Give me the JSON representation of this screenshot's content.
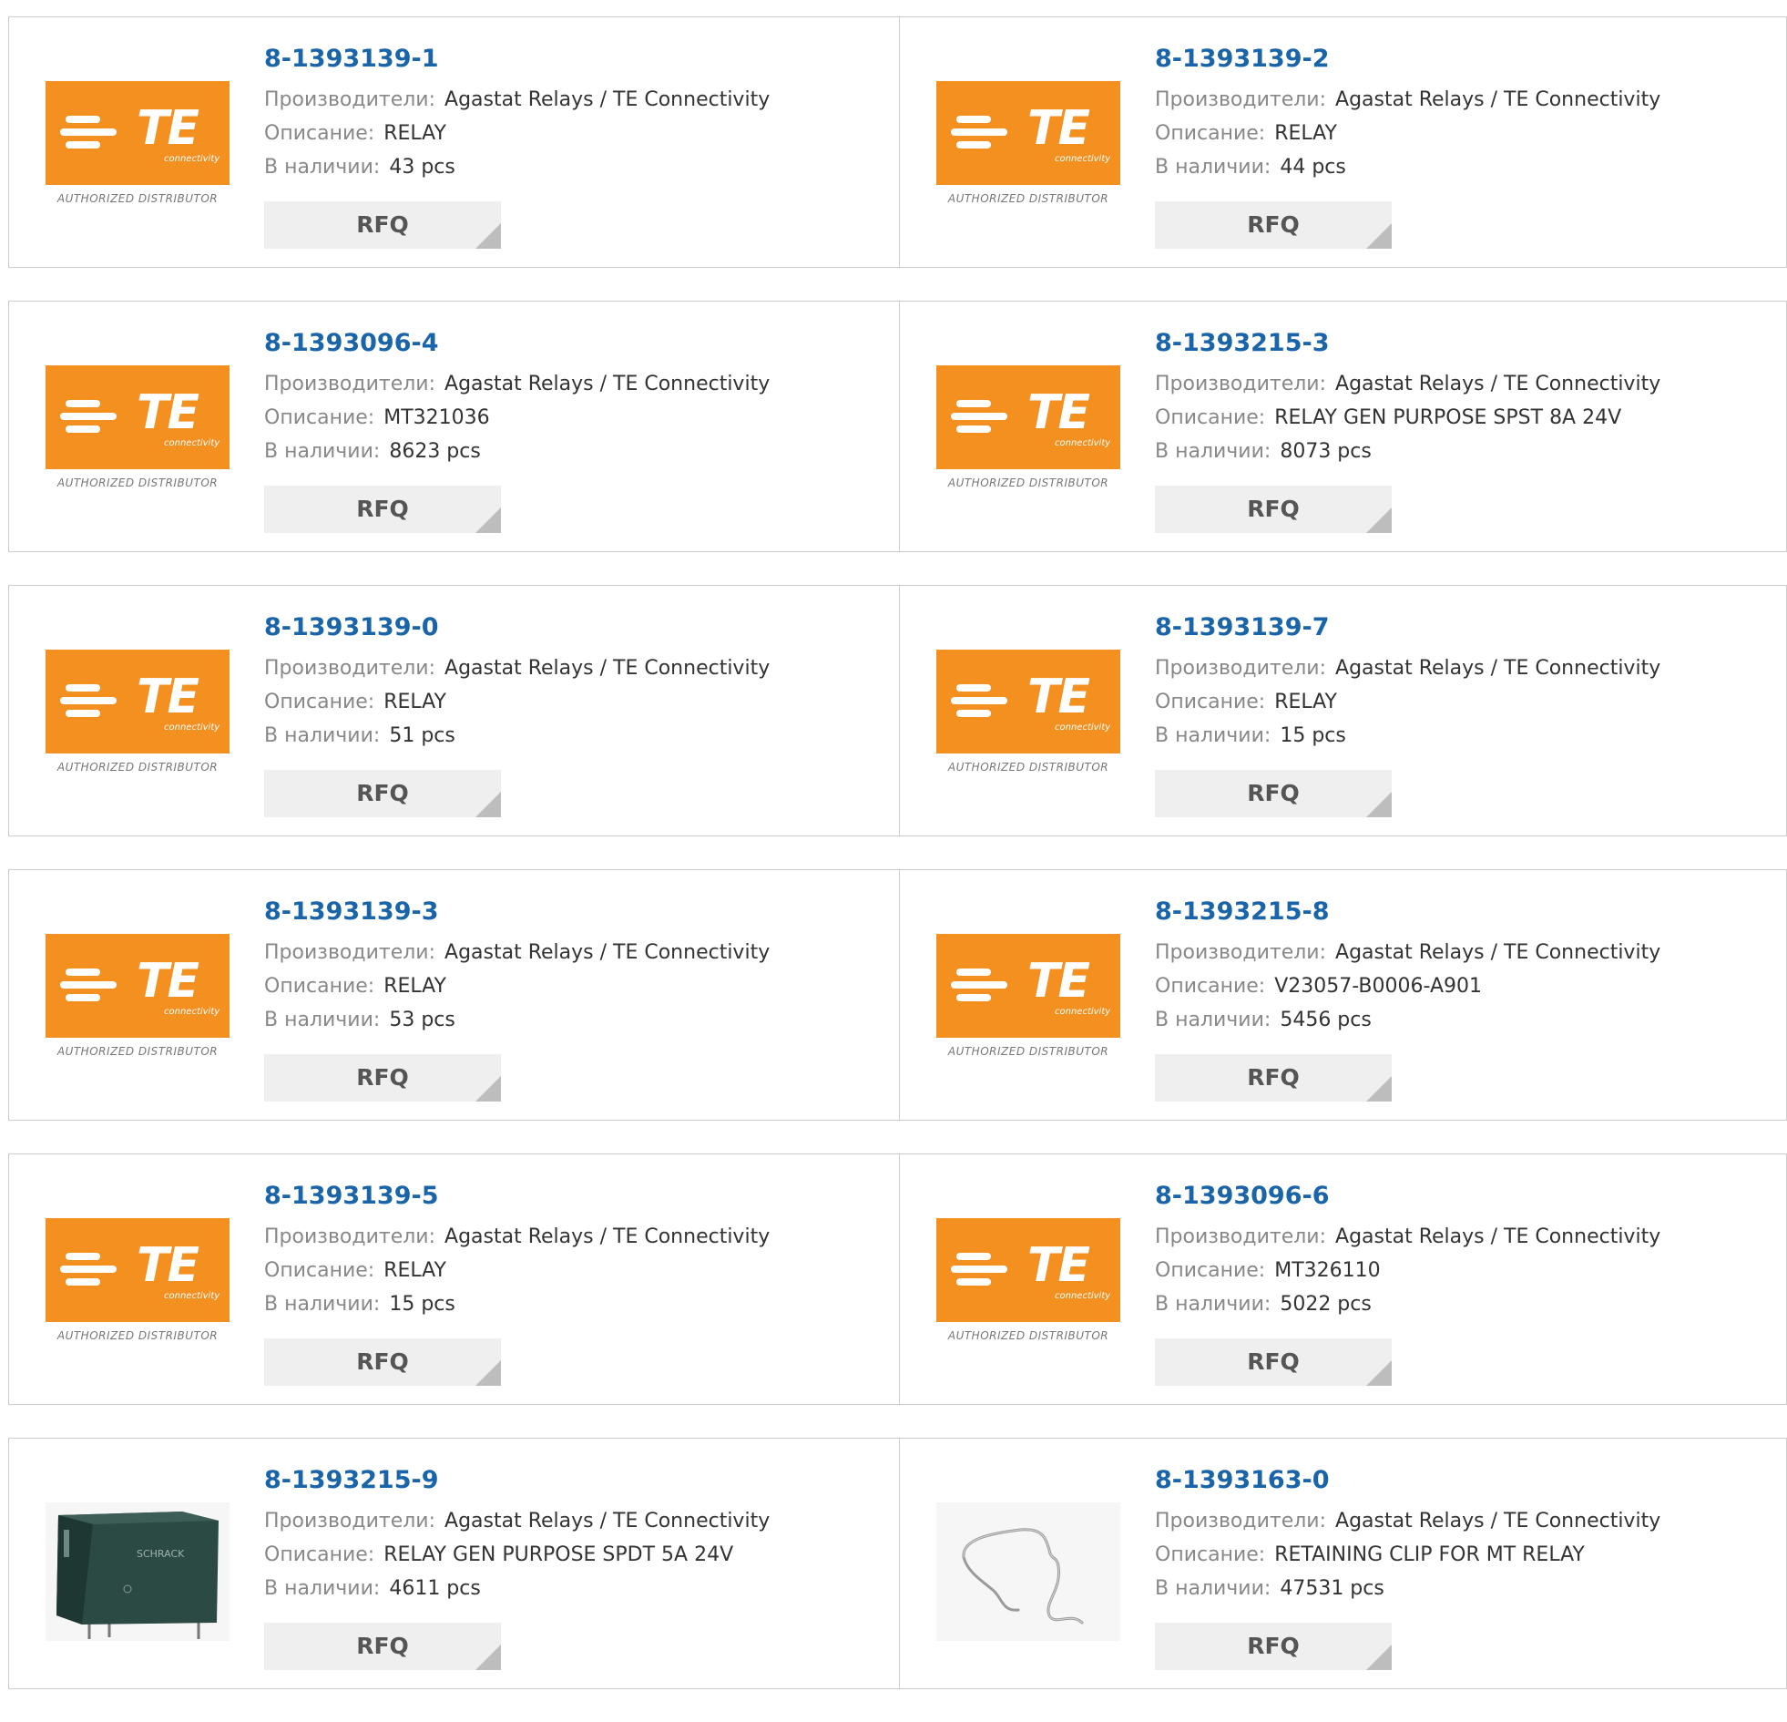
{
  "labels": {
    "manufacturer": "Производители:",
    "description": "Описание:",
    "stock": "В наличии:",
    "rfq": "RFQ"
  },
  "logo": {
    "brand": "TE",
    "sub": "connectivity",
    "tagline": "AUTHORIZED DISTRIBUTOR",
    "color": "#f39020"
  },
  "products": [
    {
      "part": "8-1393139-1",
      "manufacturer": "Agastat Relays / TE Connectivity",
      "description": "RELAY",
      "stock": "43 pcs",
      "image": "te-logo"
    },
    {
      "part": "8-1393139-2",
      "manufacturer": "Agastat Relays / TE Connectivity",
      "description": "RELAY",
      "stock": "44 pcs",
      "image": "te-logo"
    },
    {
      "part": "8-1393096-4",
      "manufacturer": "Agastat Relays / TE Connectivity",
      "description": "MT321036",
      "stock": "8623 pcs",
      "image": "te-logo"
    },
    {
      "part": "8-1393215-3",
      "manufacturer": "Agastat Relays / TE Connectivity",
      "description": "RELAY GEN PURPOSE SPST 8A 24V",
      "stock": "8073 pcs",
      "image": "te-logo"
    },
    {
      "part": "8-1393139-0",
      "manufacturer": "Agastat Relays / TE Connectivity",
      "description": "RELAY",
      "stock": "51 pcs",
      "image": "te-logo"
    },
    {
      "part": "8-1393139-7",
      "manufacturer": "Agastat Relays / TE Connectivity",
      "description": "RELAY",
      "stock": "15 pcs",
      "image": "te-logo"
    },
    {
      "part": "8-1393139-3",
      "manufacturer": "Agastat Relays / TE Connectivity",
      "description": "RELAY",
      "stock": "53 pcs",
      "image": "te-logo"
    },
    {
      "part": "8-1393215-8",
      "manufacturer": "Agastat Relays / TE Connectivity",
      "description": "V23057-B0006-A901",
      "stock": "5456 pcs",
      "image": "te-logo"
    },
    {
      "part": "8-1393139-5",
      "manufacturer": "Agastat Relays / TE Connectivity",
      "description": "RELAY",
      "stock": "15 pcs",
      "image": "te-logo"
    },
    {
      "part": "8-1393096-6",
      "manufacturer": "Agastat Relays / TE Connectivity",
      "description": "MT326110",
      "stock": "5022 pcs",
      "image": "te-logo"
    },
    {
      "part": "8-1393215-9",
      "manufacturer": "Agastat Relays / TE Connectivity",
      "description": "RELAY GEN PURPOSE SPDT 5A 24V",
      "stock": "4611 pcs",
      "image": "relay-photo",
      "image_text": "SCHRACK"
    },
    {
      "part": "8-1393163-0",
      "manufacturer": "Agastat Relays / TE Connectivity",
      "description": "RETAINING CLIP FOR MT RELAY",
      "stock": "47531 pcs",
      "image": "clip-photo"
    }
  ]
}
